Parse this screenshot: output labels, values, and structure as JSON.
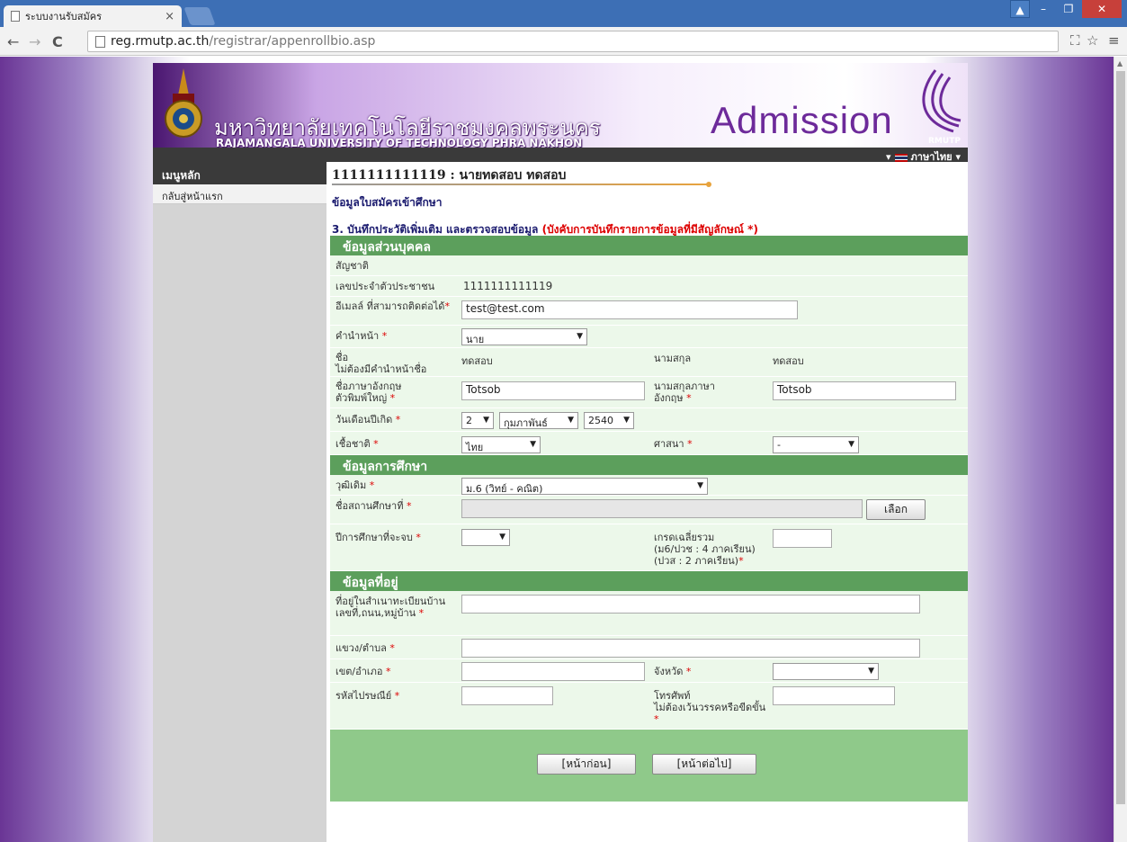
{
  "browser": {
    "tab_title": "ระบบงานรับสมัคร",
    "url_domain": "reg.rmutp.ac.th",
    "url_path": "/registrar/appenrollbio.asp"
  },
  "banner": {
    "uni_th": "มหาวิทยาลัยเทคโนโลยีราชมงคลพระนคร",
    "uni_en": "RAJAMANGALA UNIVERSITY OF TECHNOLOGY PHRA NAKHON",
    "admission": "Admission",
    "rmutp": "RMUTP",
    "lang": "ภาษาไทย"
  },
  "sidebar": {
    "heading": "เมนูหลัก",
    "item": "กลับสู่หน้าแรก"
  },
  "header": {
    "user": "1111111111119 : นายทดสอบ ทดสอบ",
    "subtitle": "ข้อมูลใบสมัครเข้าศึกษา",
    "step": "3. บันทึกประวัติเพิ่มเติม และตรวจสอบข้อมูล",
    "step_req": "(บังคับการบันทึกรายการข้อมูลที่มีสัญลักษณ์ *)"
  },
  "personal": {
    "title": "ข้อมูลส่วนบุคคล",
    "nationality_label": "สัญชาติ",
    "idcard_label": "เลขประจำตัวประชาชน",
    "idcard_value": "1111111111119",
    "email_label": "อีเมลล์ ที่สามารถติดต่อได้",
    "email_value": "test@test.com",
    "prefix_label": "คำนำหน้า",
    "prefix_value": "นาย",
    "name_label1": "ชื่อ",
    "name_label2": "ไม่ต้องมีคำนำหน้าชื่อ",
    "name_value": "ทดสอบ",
    "surname_label": "นามสกุล",
    "surname_value": "ทดสอบ",
    "name_en_label1": "ชื่อภาษาอังกฤษ",
    "name_en_label2": "ตัวพิมพ์ใหญ่",
    "name_en_value": "Totsob",
    "surname_en_label1": "นามสกุลภาษา",
    "surname_en_label2": "อังกฤษ",
    "surname_en_value": "Totsob",
    "dob_label": "วันเดือนปีเกิด",
    "dob_day": "2",
    "dob_month": "กุมภาพันธ์",
    "dob_year": "2540",
    "race_label": "เชื้อชาติ",
    "race_value": "ไทย",
    "religion_label": "ศาสนา",
    "religion_value": "-"
  },
  "education": {
    "title": "ข้อมูลการศึกษา",
    "degree_label": "วุฒิเดิม",
    "degree_value": "ม.6 (วิทย์ - คณิต)",
    "school_label": "ชื่อสถานศึกษาที่",
    "school_button": "เลือก",
    "gradyear_label": "ปีการศึกษาที่จะจบ",
    "gradyear_value": "",
    "gpa_label1": "เกรดเฉลี่ยรวม",
    "gpa_label2": "(ม6/ปวช : 4 ภาคเรียน)",
    "gpa_label3": "(ปวส : 2 ภาคเรียน)"
  },
  "address": {
    "title": "ข้อมูลที่อยู่",
    "house_label1": "ที่อยู่ในสำเนาทะเบียนบ้าน",
    "house_label2": "เลขที่,ถนน,หมู่บ้าน",
    "subdistrict_label": "แขวง/ตำบล",
    "district_label": "เขต/อำเภอ",
    "province_label": "จังหวัด",
    "postcode_label": "รหัสไปรษณีย์",
    "phone_label1": "โทรศัพท์",
    "phone_label2": "ไม่ต้องเว้นวรรคหรือขีดขั้น"
  },
  "buttons": {
    "prev": "[หน้าก่อน]",
    "next": "[หน้าต่อไป]"
  }
}
